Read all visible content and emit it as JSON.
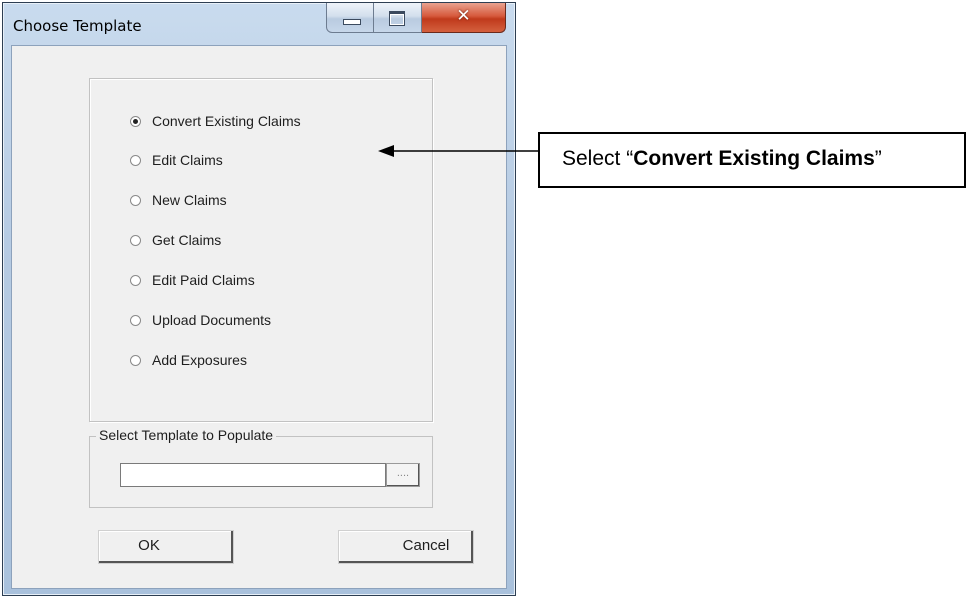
{
  "window": {
    "title": "Choose Template",
    "close_glyph": "✕",
    "browse_glyph": "...."
  },
  "options": [
    {
      "label": "Convert Existing Claims",
      "selected": true
    },
    {
      "label": "Edit Claims",
      "selected": false
    },
    {
      "label": "New Claims",
      "selected": false
    },
    {
      "label": "Get Claims",
      "selected": false
    },
    {
      "label": "Edit Paid Claims",
      "selected": false
    },
    {
      "label": "Upload Documents",
      "selected": false
    },
    {
      "label": "Add Exposures",
      "selected": false
    }
  ],
  "template_group": {
    "legend": "Select Template to Populate",
    "value": ""
  },
  "buttons": {
    "ok": "OK",
    "cancel": "Cancel"
  },
  "callout": {
    "prefix": "Select “",
    "emphasis": "Convert Existing Claims",
    "suffix": "”"
  },
  "colors": {
    "close_button": "#d0492b",
    "frame": "#b6cbe3",
    "client": "#f0f0f0"
  },
  "icons": {
    "minimize": "minimize-icon",
    "maximize": "maximize-icon",
    "close": "close-icon",
    "arrow": "left-arrow-icon"
  }
}
